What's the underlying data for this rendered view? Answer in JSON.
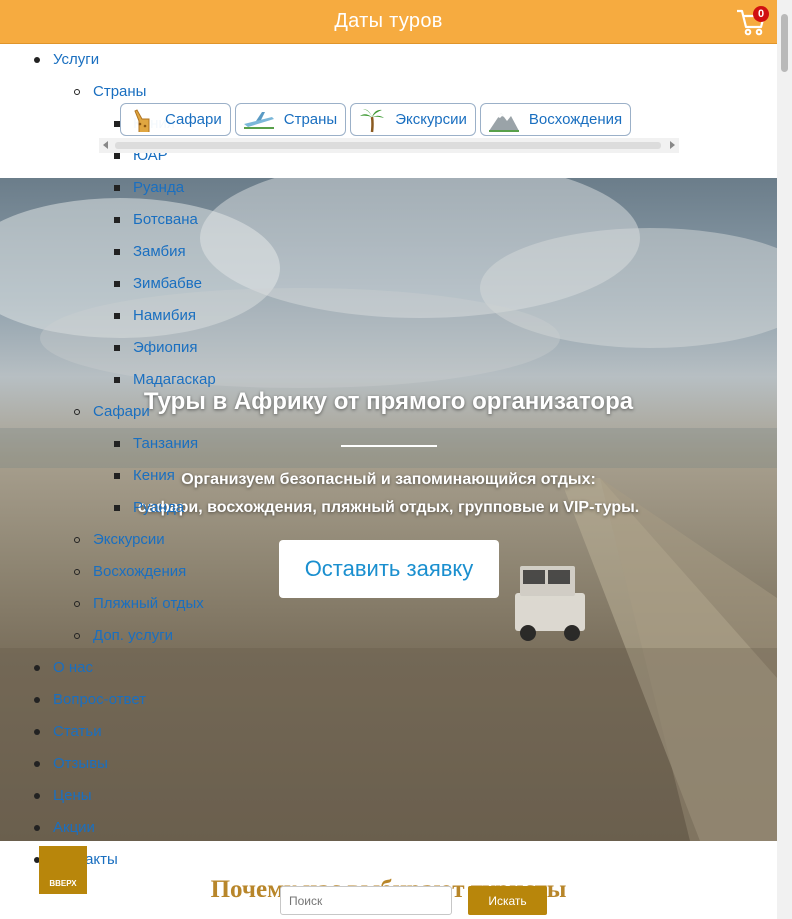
{
  "header": {
    "title": "Даты туров",
    "cart_count": "0"
  },
  "nav": {
    "items": [
      {
        "label": "Услуги",
        "level": 1
      },
      {
        "label": "Страны",
        "level": 2
      },
      {
        "label": "Кения",
        "level": 3
      },
      {
        "label": "ЮАР",
        "level": 3
      },
      {
        "label": "Руанда",
        "level": 3
      },
      {
        "label": "Ботсвана",
        "level": 3
      },
      {
        "label": "Замбия",
        "level": 3
      },
      {
        "label": "Зимбабве",
        "level": 3
      },
      {
        "label": "Намибия",
        "level": 3
      },
      {
        "label": "Эфиопия",
        "level": 3
      },
      {
        "label": "Мадагаскар",
        "level": 3
      },
      {
        "label": "Сафари",
        "level": 2
      },
      {
        "label": "Танзания",
        "level": 3
      },
      {
        "label": "Кения",
        "level": 3
      },
      {
        "label": "Руанда",
        "level": 3
      },
      {
        "label": "Экскурсии",
        "level": 2
      },
      {
        "label": "Восхождения",
        "level": 2
      },
      {
        "label": "Пляжный отдых",
        "level": 2
      },
      {
        "label": "Доп. услуги",
        "level": 2
      },
      {
        "label": "О нас",
        "level": 1
      },
      {
        "label": "Вопрос-ответ",
        "level": 1
      },
      {
        "label": "Статьи",
        "level": 1
      },
      {
        "label": "Отзывы",
        "level": 1
      },
      {
        "label": "Цены",
        "level": 1
      },
      {
        "label": "Акции",
        "level": 1
      },
      {
        "label": "Контакты",
        "level": 1
      }
    ]
  },
  "categories": [
    {
      "label": "Сафари",
      "icon": "giraffe-icon"
    },
    {
      "label": "Страны",
      "icon": "airplane-icon"
    },
    {
      "label": "Экскурсии",
      "icon": "palm-icon"
    },
    {
      "label": "Восхождения",
      "icon": "mountain-icon"
    }
  ],
  "hero": {
    "title": "Туры в Африку от прямого организатора",
    "subtitle_line1": "Организуем безопасный и запоминающийся отдых:",
    "subtitle_line2": "сафари, восхождения, пляжный отдых, групповые и VIP-туры.",
    "cta": "Оставить заявку"
  },
  "section": {
    "why_title": "Почему нас выбирают туристы"
  },
  "up_button": "ВВЕРХ",
  "search": {
    "placeholder": "Поиск",
    "button": "Искать"
  },
  "colors": {
    "topbar": "#f6ab40",
    "accent": "#b8860b",
    "link": "#1a6fc0"
  }
}
